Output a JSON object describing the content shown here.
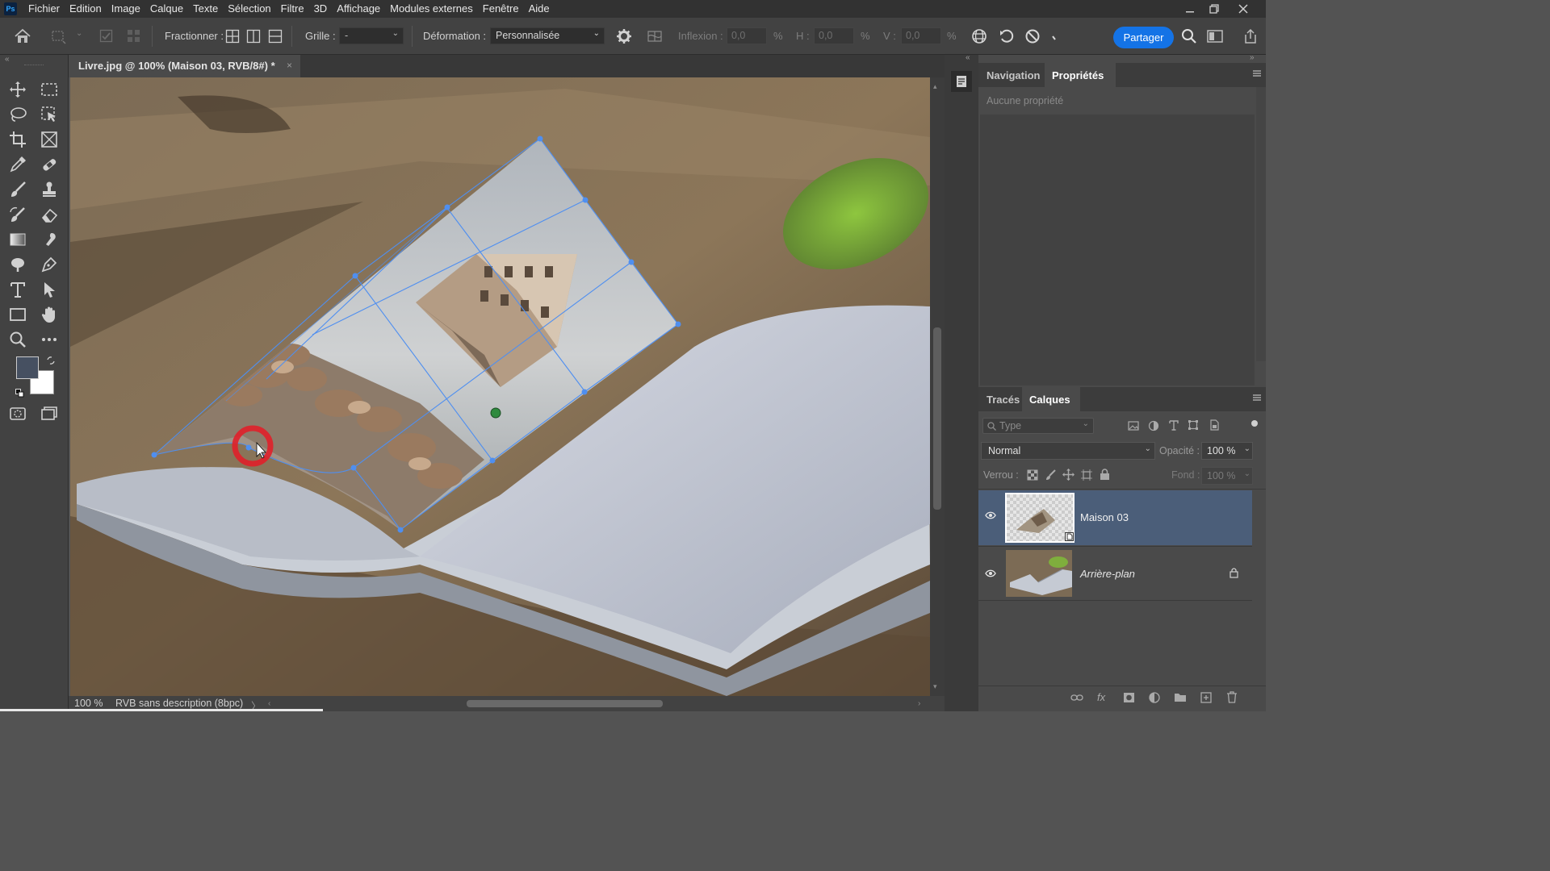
{
  "app": {
    "logo": "Ps"
  },
  "menu": [
    "Fichier",
    "Edition",
    "Image",
    "Calque",
    "Texte",
    "Sélection",
    "Filtre",
    "3D",
    "Affichage",
    "Modules externes",
    "Fenêtre",
    "Aide"
  ],
  "options": {
    "split_label": "Fractionner :",
    "grid_label": "Grille :",
    "grid_value": "-",
    "warp_label": "Déformation :",
    "warp_value": "Personnalisée",
    "bend_label": "Inflexion :",
    "bend_value": "0,0",
    "h_label": "H :",
    "h_value": "0,0",
    "v_label": "V :",
    "v_value": "0,0",
    "percent": "%",
    "share_label": "Partager"
  },
  "document": {
    "tab_title": "Livre.jpg @ 100% (Maison 03, RVB/8#) *",
    "close_glyph": "×",
    "zoom": "100 %",
    "color_profile": "RVB sans description (8bpc)",
    "arrow": "〉"
  },
  "properties_panel": {
    "tabs": [
      "Navigation",
      "Propriétés"
    ],
    "active_tab": "Propriétés",
    "empty_text": "Aucune propriété"
  },
  "layers_panel": {
    "tabs": [
      "Tracés",
      "Calques"
    ],
    "active_tab": "Calques",
    "search_placeholder": "Type",
    "blend_mode": "Normal",
    "opacity_label": "Opacité :",
    "opacity_value": "100 %",
    "lock_label": "Verrou :",
    "fill_label": "Fond :",
    "fill_value": "100 %",
    "layers": [
      {
        "name": "Maison 03",
        "selected": true,
        "visible": true,
        "locked": false
      },
      {
        "name": "Arrière-plan",
        "selected": false,
        "visible": true,
        "locked": true
      }
    ]
  },
  "colors": {
    "accent": "#1473e6",
    "selected_layer": "#4b5e79",
    "warp_mesh": "#4f8ff0",
    "cursor_ring": "#e0202a",
    "foreground_swatch": "#465061",
    "background_swatch": "#ffffff"
  }
}
